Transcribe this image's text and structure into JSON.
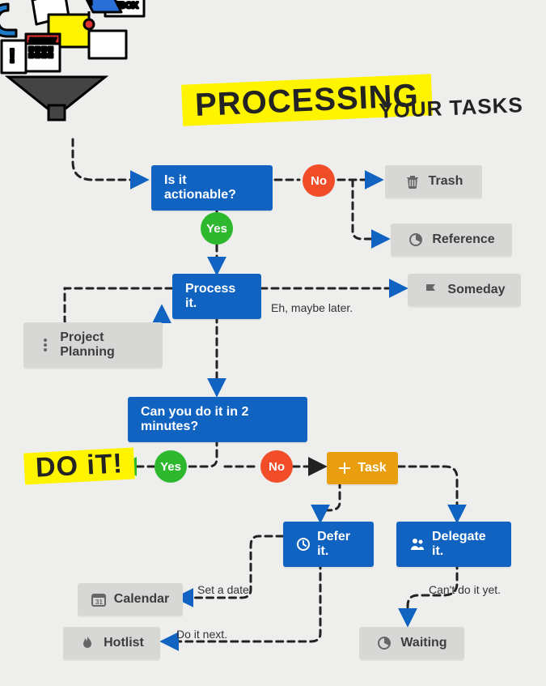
{
  "title": {
    "main": "PROCESSiNG",
    "rest": "YOUR TASKS"
  },
  "nodes": {
    "actionable": "Is it actionable?",
    "process": "Process it.",
    "twomin": "Can you do it in 2 minutes?",
    "task": "Task",
    "defer": "Defer it.",
    "delegate": "Delegate it."
  },
  "pills": {
    "yes1": "Yes",
    "no1": "No",
    "yes2": "Yes",
    "no2": "No"
  },
  "outcomes": {
    "trash": "Trash",
    "reference": "Reference",
    "someday": "Someday",
    "planning": "Project Planning",
    "calendar": "Calendar",
    "hotlist": "Hotlist",
    "waiting": "Waiting"
  },
  "captions": {
    "maybe": "Eh, maybe later.",
    "setdate": "Set a date.",
    "donext": "Do it next.",
    "cantyet": "Can't do it yet."
  },
  "doit": "DO iT!"
}
